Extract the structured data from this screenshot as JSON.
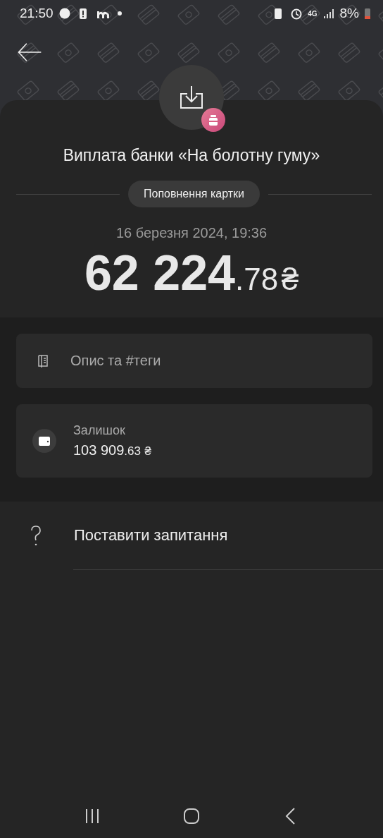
{
  "status_bar": {
    "time": "21:50",
    "network": "4G",
    "battery": "8%"
  },
  "transaction": {
    "title": "Виплата банки «На болотну гуму»",
    "category": "Поповнення картки",
    "date": "16 березня 2024, 19:36",
    "amount_main": "62 224",
    "amount_fraction": ".78",
    "currency": "₴"
  },
  "description": {
    "placeholder": "Опис та #теги"
  },
  "balance": {
    "label": "Залишок",
    "amount_main": "103 909",
    "amount_fraction": ".63",
    "currency": "₴"
  },
  "question": {
    "label": "Поставити запитання"
  }
}
